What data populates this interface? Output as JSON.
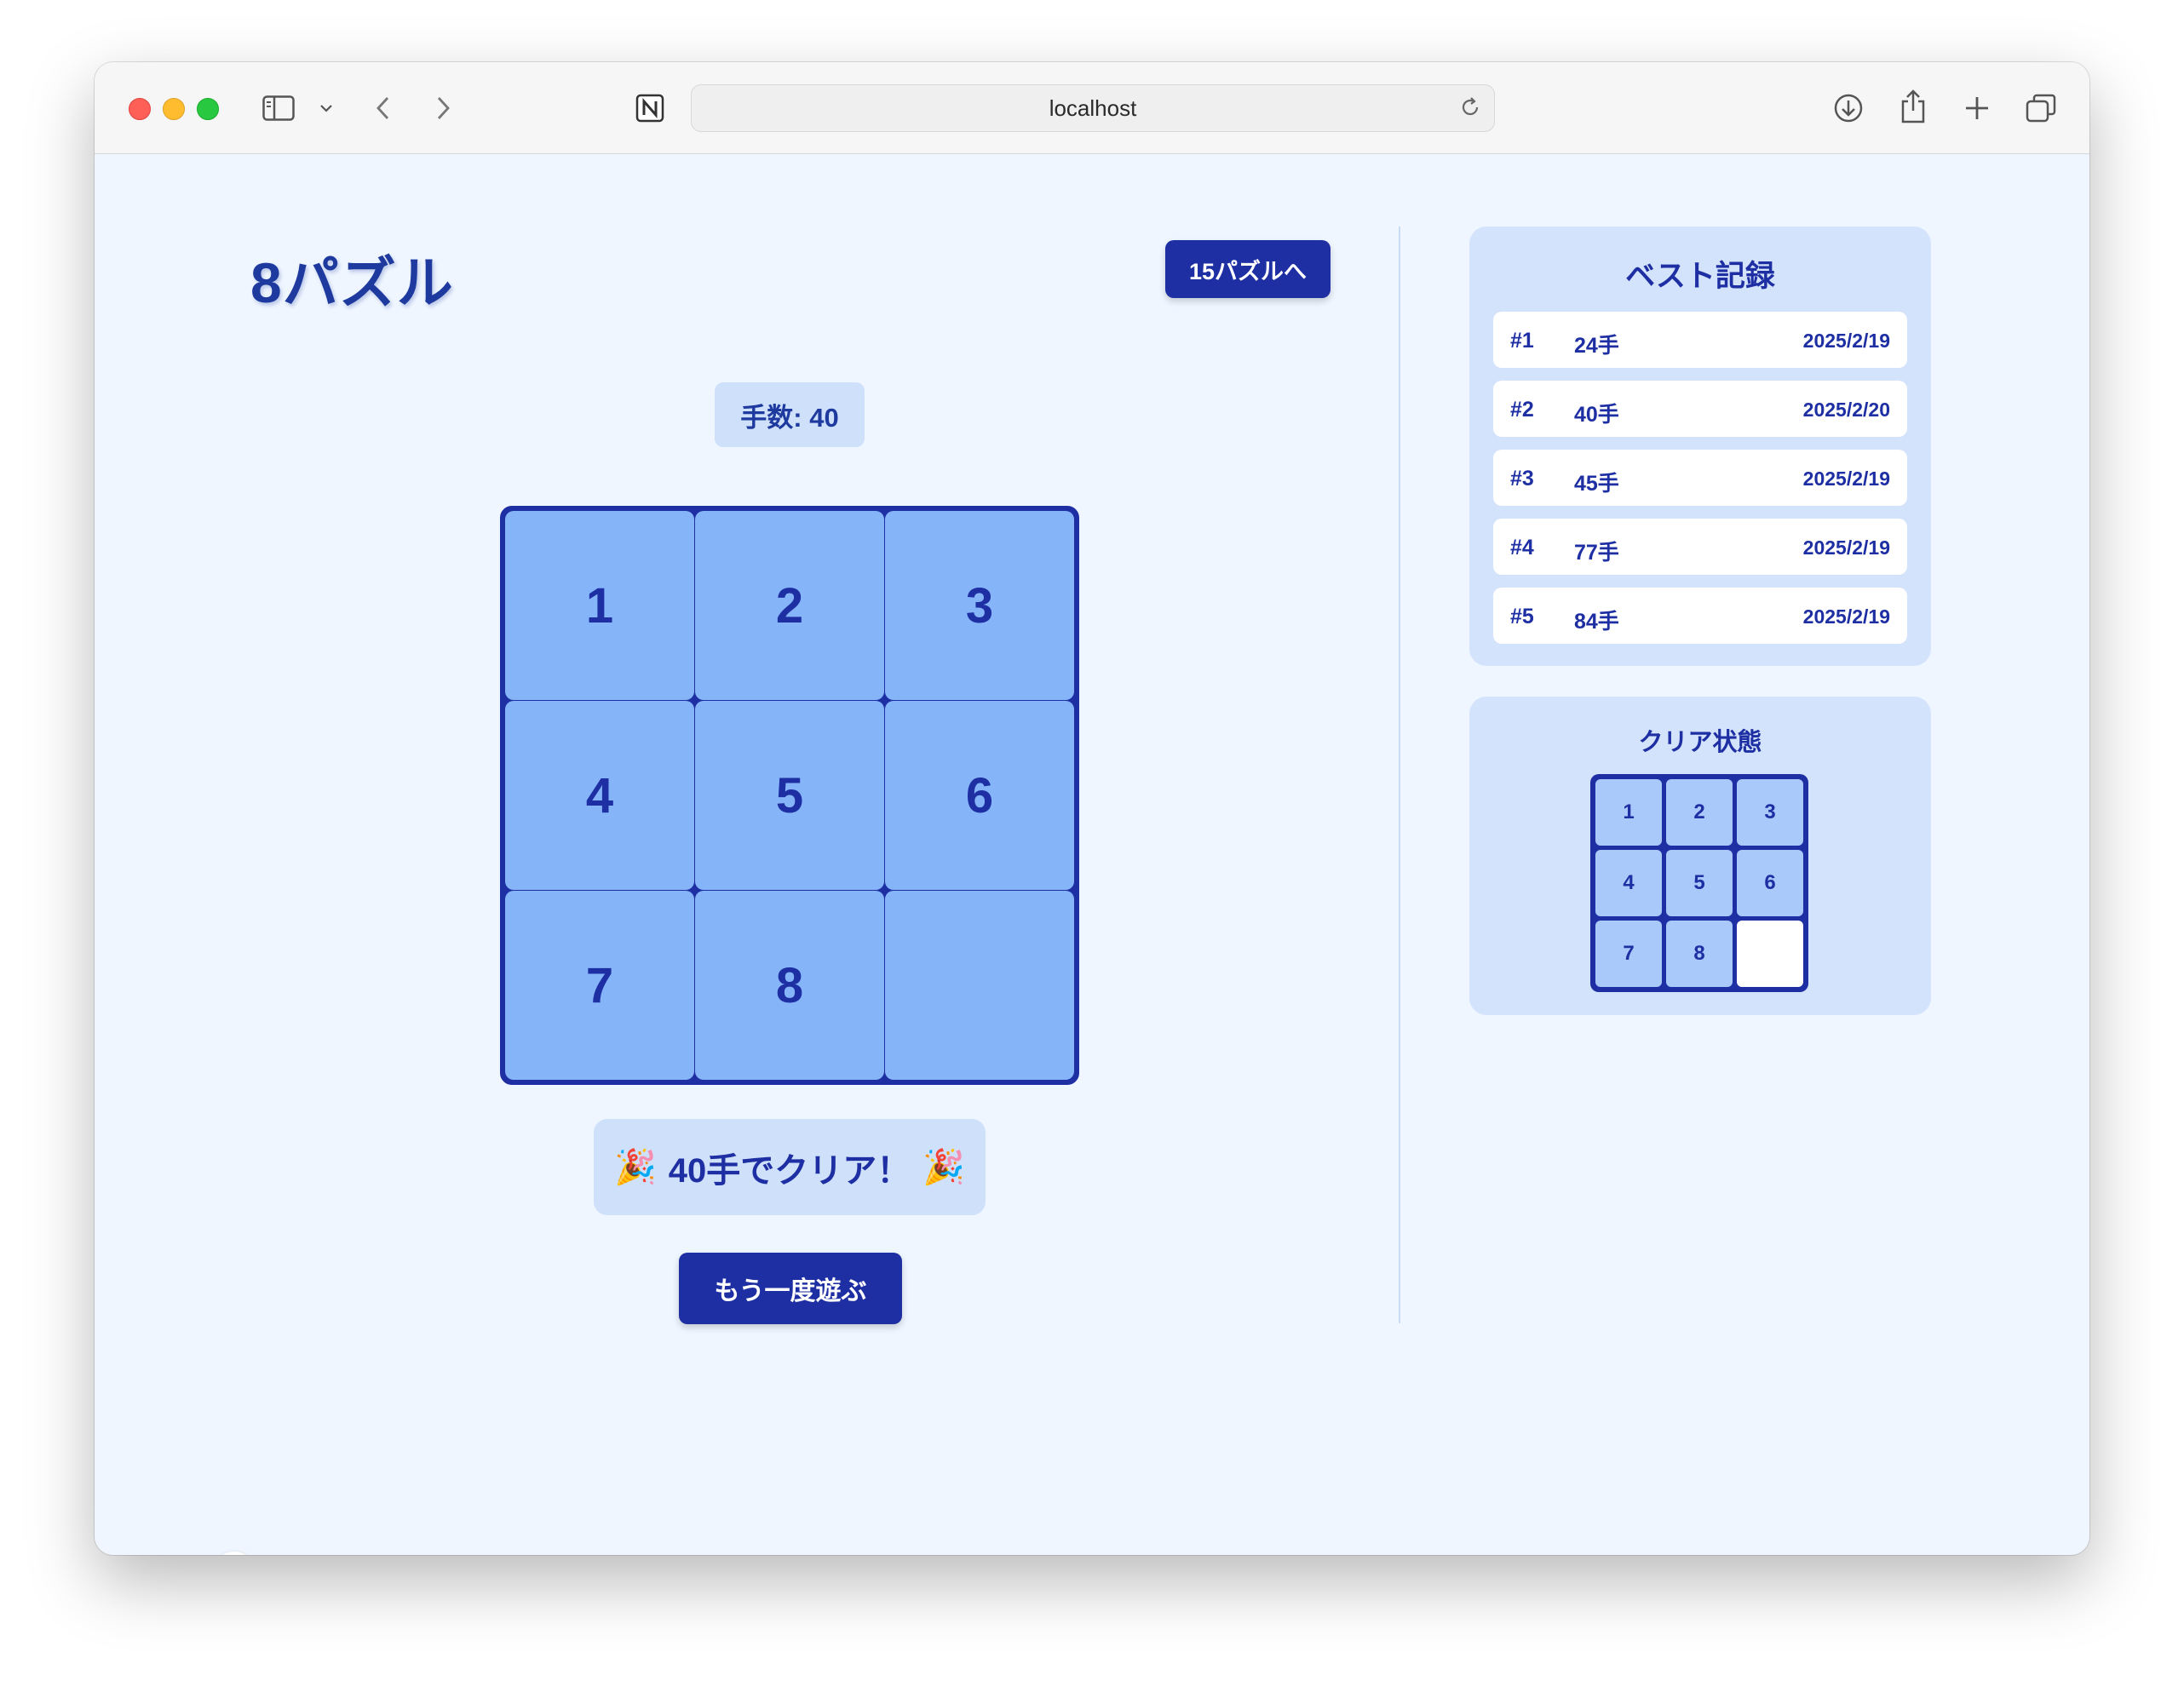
{
  "browser": {
    "url": "localhost"
  },
  "game": {
    "title": "8パズル",
    "switch_button": "15パズルへ",
    "moves_label": "手数: 40",
    "tiles": [
      "1",
      "2",
      "3",
      "4",
      "5",
      "6",
      "7",
      "8",
      ""
    ],
    "clear_emoji": "🎉",
    "clear_message": "40手でクリア！",
    "replay_button": "もう一度遊ぶ"
  },
  "best_records": {
    "title": "ベスト記録",
    "items": [
      {
        "rank": "#1",
        "moves": "24手",
        "date": "2025/2/19"
      },
      {
        "rank": "#2",
        "moves": "40手",
        "date": "2025/2/20"
      },
      {
        "rank": "#3",
        "moves": "45手",
        "date": "2025/2/19"
      },
      {
        "rank": "#4",
        "moves": "77手",
        "date": "2025/2/19"
      },
      {
        "rank": "#5",
        "moves": "84手",
        "date": "2025/2/19"
      }
    ]
  },
  "clear_state": {
    "title": "クリア状態",
    "tiles": [
      "1",
      "2",
      "3",
      "4",
      "5",
      "6",
      "7",
      "8",
      ""
    ]
  },
  "colors": {
    "accent": "#1e2ea3",
    "tile": "#85b5f8",
    "panel": "#d3e3fc",
    "background": "#eff6ff"
  }
}
